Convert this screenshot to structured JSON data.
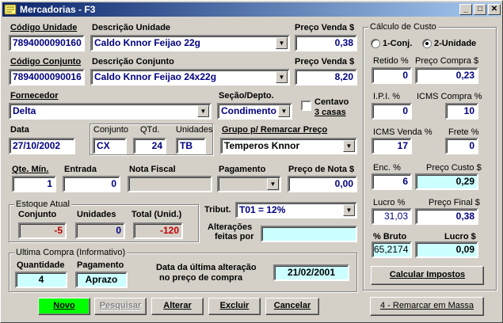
{
  "window": {
    "title": "Mercadorias - F3",
    "controls": [
      "_",
      "□",
      "✕"
    ]
  },
  "unidade": {
    "codigo_label": "Código Unidade",
    "codigo": "7894000090160",
    "descricao_label": "Descrição Unidade",
    "descricao": "Caldo Knnor Feijao 22g",
    "preco_label": "Preço Venda $",
    "preco": "0,38"
  },
  "conjunto": {
    "codigo_label": "Código Conjunto",
    "codigo": "7894000090016",
    "descricao_label": "Descrição Conjunto",
    "descricao": "Caldo Knnor Feijao 24x22g",
    "preco_label": "Preço Venda $",
    "preco": "8,20"
  },
  "fornecedor": {
    "label": "Fornecedor",
    "value": "Delta"
  },
  "secao": {
    "label": "Seção/Depto.",
    "value": "Condimento"
  },
  "centavo": {
    "label_line1": "Centavo",
    "label_line2": "3 casas",
    "checked": false
  },
  "data": {
    "label": "Data",
    "value": "27/10/2002"
  },
  "embalagem": {
    "conjunto_label": "Conjunto",
    "conjunto": "CX",
    "qtd_label": "QTd.",
    "qtd": "24",
    "unidades_label": "Unidades",
    "unidades": "TB"
  },
  "grupo": {
    "label": "Grupo p/ Remarcar Preço",
    "value": "Temperos Knnor"
  },
  "entrada_row": {
    "qte_min_label": "Qte. Mín.",
    "qte_min": "1",
    "entrada_label": "Entrada",
    "entrada": "0",
    "nota_fiscal_label": "Nota Fiscal",
    "nota_fiscal": "",
    "pagamento_label": "Pagamento",
    "pagamento": "",
    "preco_nota_label": "Preço de Nota $",
    "preco_nota": "0,00"
  },
  "estoque": {
    "title": "Estoque Atual",
    "conjunto_label": "Conjunto",
    "conjunto": "-5",
    "unidades_label": "Unidades",
    "unidades": "0",
    "total_label": "Total (Unid.)",
    "total": "-120"
  },
  "tributacao": {
    "label": "Tribut.",
    "value": "T01 = 12%"
  },
  "alteracoes": {
    "label_line1": "Alterações",
    "label_line2": "feitas por",
    "value": ""
  },
  "ultima_compra": {
    "title": "Ultima Compra (Informativo)",
    "quantidade_label": "Quantidade",
    "quantidade": "4",
    "pagamento_label": "Pagamento",
    "pagamento": "Aprazo",
    "alteracao_label_line1": "Data da última alteração",
    "alteracao_label_line2": "no preço de compra",
    "alteracao": "21/02/2001"
  },
  "calculo": {
    "title": "Cálculo de Custo",
    "radio1": "1-Conj.",
    "radio2": "2-Unidade",
    "selected": "2-Unidade",
    "retido_label": "Retido %",
    "retido": "0",
    "preco_compra_label": "Preço Compra $",
    "preco_compra": "0,23",
    "ipi_label": "I.P.I. %",
    "ipi": "0",
    "icms_compra_label": "ICMS Compra %",
    "icms_compra": "10",
    "icms_venda_label": "ICMS Venda %",
    "icms_venda": "17",
    "frete_label": "Frete %",
    "frete": "0",
    "enc_label": "Enc. %",
    "enc": "6",
    "preco_custo_label": "Preço Custo $",
    "preco_custo": "0,29",
    "lucro_label": "Lucro %",
    "lucro": "31,03",
    "preco_final_label": "Preço Final $",
    "preco_final": "0,38",
    "bruto_label": "% Bruto",
    "bruto": "65,2174",
    "lucro_valor_label": "Lucro $",
    "lucro_valor": "0,09",
    "calcular_label": "Calcular Impostos"
  },
  "buttons": {
    "novo": "Novo",
    "pesquisar": "Pesquisar",
    "alterar": "Alterar",
    "excluir": "Excluir",
    "cancelar": "Cancelar",
    "remarcar": "4 - Remarcar em Massa"
  },
  "colors": {
    "title_start": "#0a246a",
    "title_end": "#a6caf0",
    "face": "#d4d0c8",
    "value_blue": "#000080",
    "value_red": "#c00000",
    "highlight_cyan": "#ccffff",
    "novo_green": "#00ff00"
  }
}
